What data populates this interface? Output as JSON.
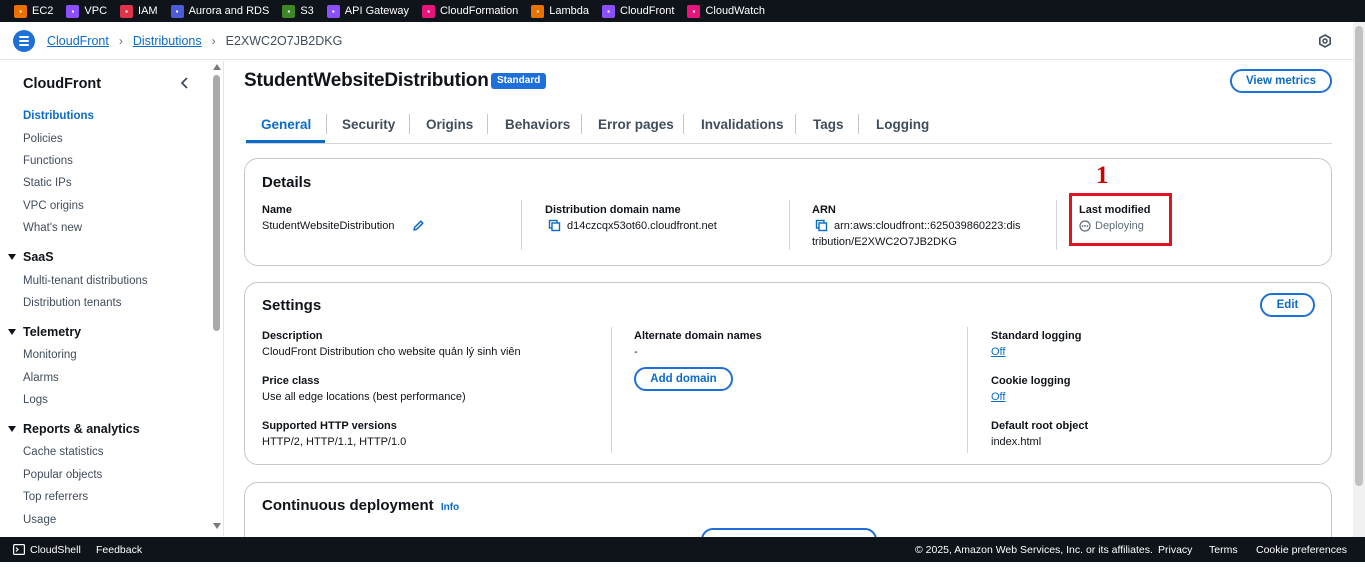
{
  "services": [
    {
      "label": "EC2",
      "icon": "ec2-icon",
      "color": "#ed7100"
    },
    {
      "label": "VPC",
      "icon": "vpc-icon",
      "color": "#8c4fff"
    },
    {
      "label": "IAM",
      "icon": "iam-icon",
      "color": "#dd344c"
    },
    {
      "label": "Aurora and RDS",
      "icon": "rds-icon",
      "color": "#4d5bd9"
    },
    {
      "label": "S3",
      "icon": "s3-icon",
      "color": "#3f8624"
    },
    {
      "label": "API Gateway",
      "icon": "api-gateway-icon",
      "color": "#8c4fff"
    },
    {
      "label": "CloudFormation",
      "icon": "cloudformation-icon",
      "color": "#e7157b"
    },
    {
      "label": "Lambda",
      "icon": "lambda-icon",
      "color": "#ed7100"
    },
    {
      "label": "CloudFront",
      "icon": "cloudfront-icon",
      "color": "#8c4fff"
    },
    {
      "label": "CloudWatch",
      "icon": "cloudwatch-icon",
      "color": "#e7157b"
    }
  ],
  "breadcrumb": {
    "root": "CloudFront",
    "section": "Distributions",
    "current": "E2XWC2O7JB2DKG"
  },
  "sidebar": {
    "title": "CloudFront",
    "items": [
      "Distributions",
      "Policies",
      "Functions",
      "Static IPs",
      "VPC origins",
      "What's new"
    ],
    "groups": [
      {
        "title": "SaaS",
        "items": [
          "Multi-tenant distributions",
          "Distribution tenants"
        ]
      },
      {
        "title": "Telemetry",
        "items": [
          "Monitoring",
          "Alarms",
          "Logs"
        ]
      },
      {
        "title": "Reports & analytics",
        "items": [
          "Cache statistics",
          "Popular objects",
          "Top referrers",
          "Usage"
        ]
      }
    ]
  },
  "header": {
    "title": "StudentWebsiteDistribution",
    "badge": "Standard",
    "view_metrics": "View metrics"
  },
  "tabs": [
    "General",
    "Security",
    "Origins",
    "Behaviors",
    "Error pages",
    "Invalidations",
    "Tags",
    "Logging"
  ],
  "details": {
    "heading": "Details",
    "name_label": "Name",
    "name_value": "StudentWebsiteDistribution",
    "domain_label": "Distribution domain name",
    "domain_value": "d14czcqx53ot60.cloudfront.net",
    "arn_label": "ARN",
    "arn_line1": "arn:aws:cloudfront::625039860223:dis",
    "arn_line2": "tribution/E2XWC2O7JB2DKG",
    "modified_label": "Last modified",
    "modified_value": "Deploying"
  },
  "annotation": "1",
  "settings": {
    "heading": "Settings",
    "edit": "Edit",
    "description_label": "Description",
    "description_value": "CloudFront Distribution cho website quản lý sinh viên",
    "price_label": "Price class",
    "price_value": "Use all edge locations (best performance)",
    "http_label": "Supported HTTP versions",
    "http_value": "HTTP/2, HTTP/1.1, HTTP/1.0",
    "alt_label": "Alternate domain names",
    "alt_value": "-",
    "add_domain": "Add domain",
    "std_logging_label": "Standard logging",
    "std_logging_value": "Off",
    "cookie_label": "Cookie logging",
    "cookie_value": "Off",
    "root_label": "Default root object",
    "root_value": "index.html"
  },
  "continuous": {
    "heading": "Continuous deployment",
    "info": "Info"
  },
  "footer": {
    "cloudshell": "CloudShell",
    "feedback": "Feedback",
    "copyright": "© 2025, Amazon Web Services, Inc. or its affiliates.",
    "privacy": "Privacy",
    "terms": "Terms",
    "cookies": "Cookie preferences"
  }
}
